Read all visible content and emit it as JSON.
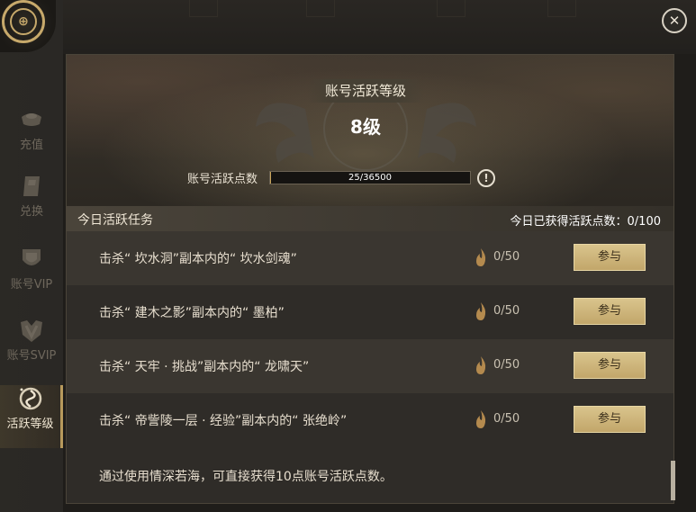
{
  "sidebar": {
    "items": [
      {
        "label": "充值",
        "icon": "ingot-icon",
        "active": false
      },
      {
        "label": "兑换",
        "icon": "exchange-icon",
        "active": false
      },
      {
        "label": "账号VIP",
        "icon": "vip-shield-icon",
        "active": false
      },
      {
        "label": "账号SVIP",
        "icon": "svip-emblem-icon",
        "active": false
      },
      {
        "label": "活跃等级",
        "icon": "activity-swirl-icon",
        "active": true
      }
    ]
  },
  "header": {
    "level_title": "账号活跃等级",
    "level_value": "8级",
    "points_label": "账号活跃点数",
    "points_text": "25/36500",
    "points_current": 25,
    "points_max": 36500
  },
  "section": {
    "title": "今日活跃任务",
    "daily_total": "今日已获得活跃点数：0/100"
  },
  "tasks": [
    {
      "text": "击杀“ 坎水洞”副本内的“ 坎水剑魂”",
      "progress": "0/50",
      "button": "参与"
    },
    {
      "text": "击杀“ 建木之影”副本内的“ 墨柏”",
      "progress": "0/50",
      "button": "参与"
    },
    {
      "text": "击杀“ 天牢 · 挑战”副本内的“ 龙啸天”",
      "progress": "0/50",
      "button": "参与"
    },
    {
      "text": "击杀“ 帝訾陵一层 · 经验”副本内的“ 张绝岭”",
      "progress": "0/50",
      "button": "参与"
    }
  ],
  "footer_note": "通过使用情深若海，可直接获得10点账号活跃点数。",
  "colors": {
    "accent_gold": "#c9a45a",
    "button_gold": "#d9c48c"
  }
}
